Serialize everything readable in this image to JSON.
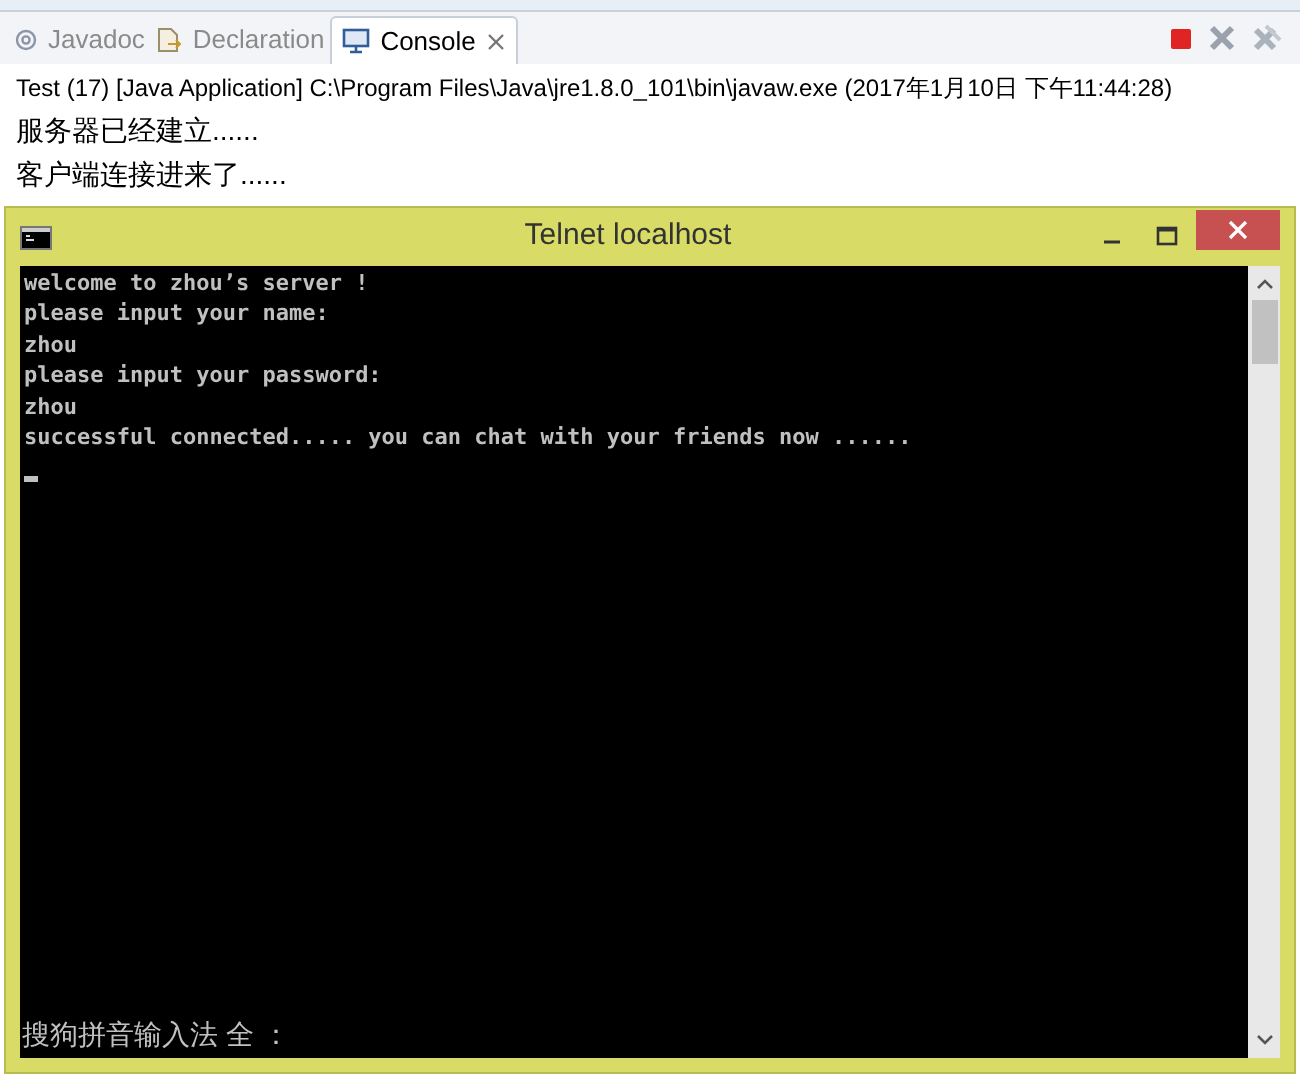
{
  "eclipse": {
    "tabs": [
      {
        "label": "Javadoc",
        "selected": false
      },
      {
        "label": "Declaration",
        "selected": false
      },
      {
        "label": "Console",
        "selected": true
      }
    ],
    "launch_info": "Test (17) [Java Application] C:\\Program Files\\Java\\jre1.8.0_101\\bin\\javaw.exe (2017年1月10日 下午11:44:28)",
    "console_lines": [
      "服务器已经建立......",
      "客户端连接进来了......"
    ]
  },
  "telnet": {
    "title": "Telnet localhost",
    "lines": [
      "welcome to zhou’s server !",
      "please input your name:",
      "zhou",
      "please input your password:",
      "zhou",
      "successful connected..... you can chat with your friends now ......"
    ],
    "ime_status": "搜狗拼音输入法 全 ："
  }
}
